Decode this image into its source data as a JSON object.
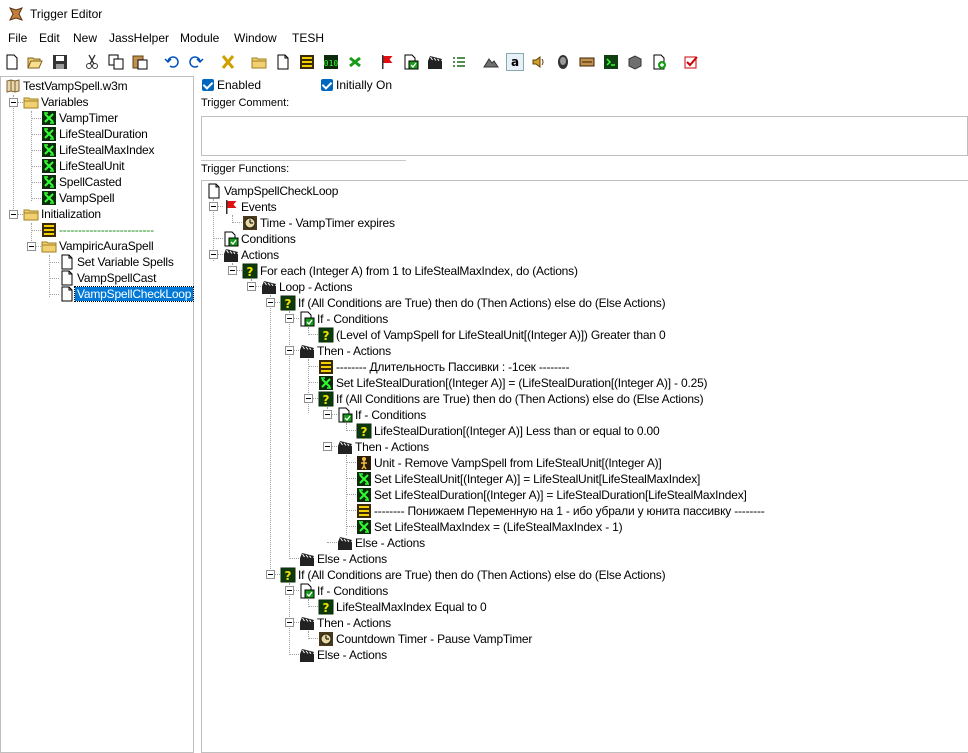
{
  "window": {
    "title": "Trigger Editor"
  },
  "menu": [
    "File",
    "Edit",
    "New",
    "JassHelper",
    "Module",
    "Window",
    "TESH"
  ],
  "toolbar_icons": [
    "new-icon",
    "open-icon",
    "save-icon",
    "cut-icon",
    "copy-icon",
    "paste-icon",
    "undo-icon",
    "redo-icon",
    "delete-icon",
    "folder-icon",
    "trigger-icon",
    "comment-icon",
    "variable-icon",
    "event-icon",
    "condition-icon",
    "action-icon",
    "checklist-icon",
    "terrain-icon",
    "object-icon",
    "sound-icon",
    "ai-icon",
    "campaign-icon",
    "import-icon",
    "script-icon",
    "map-icon",
    "test-icon"
  ],
  "left_tree": {
    "map": "TestVampSpell.w3m",
    "variables_folder": "Variables",
    "variables": [
      "VampTimer",
      "LifeStealDuration",
      "LifeStealMaxIndex",
      "LifeStealUnit",
      "SpellCasted",
      "VampSpell"
    ],
    "init_folder": "Initialization",
    "init_comment": "-------------------------",
    "spell_folder": "VampiricAuraSpell",
    "triggers": [
      "Set Variable Spells",
      "VampSpellCast",
      "VampSpellCheckLoop"
    ]
  },
  "panel": {
    "enabled": "Enabled",
    "initially_on": "Initially On",
    "comment_label": "Trigger Comment:",
    "functions_label": "Trigger Functions:"
  },
  "functions": [
    {
      "text": "VampSpellCheckLoop",
      "icon": "trigger"
    },
    {
      "text": "Events",
      "icon": "event"
    },
    {
      "text": "Time - VampTimer expires",
      "icon": "timer"
    },
    {
      "text": "Conditions",
      "icon": "condition"
    },
    {
      "text": "Actions",
      "icon": "action"
    },
    {
      "text": "For each (Integer A) from 1 to LifeStealMaxIndex, do (Actions)",
      "icon": "question"
    },
    {
      "text": "Loop - Actions",
      "icon": "action"
    },
    {
      "text": "If (All Conditions are True) then do (Then Actions) else do (Else Actions)",
      "icon": "question"
    },
    {
      "text": "If - Conditions",
      "icon": "condition"
    },
    {
      "text": "(Level of VampSpell for LifeStealUnit[(Integer A)]) Greater than 0",
      "icon": "question"
    },
    {
      "text": "Then - Actions",
      "icon": "action"
    },
    {
      "text": "-------- Длительность Пассивки : -1сек --------",
      "icon": "comment"
    },
    {
      "text": "Set LifeStealDuration[(Integer A)] = (LifeStealDuration[(Integer A)] - 0.25)",
      "icon": "variable"
    },
    {
      "text": "If (All Conditions are True) then do (Then Actions) else do (Else Actions)",
      "icon": "question"
    },
    {
      "text": "If - Conditions",
      "icon": "condition"
    },
    {
      "text": "LifeStealDuration[(Integer A)] Less than or equal to 0.00",
      "icon": "question"
    },
    {
      "text": "Then - Actions",
      "icon": "action"
    },
    {
      "text": "Unit - Remove VampSpell from LifeStealUnit[(Integer A)]",
      "icon": "unit"
    },
    {
      "text": "Set LifeStealUnit[(Integer A)] = LifeStealUnit[LifeStealMaxIndex]",
      "icon": "variable"
    },
    {
      "text": "Set LifeStealDuration[(Integer A)] = LifeStealDuration[LifeStealMaxIndex]",
      "icon": "variable"
    },
    {
      "text": "-------- Понижаем Переменную на 1 - ибо убрали у юнита пассивку --------",
      "icon": "comment"
    },
    {
      "text": "Set LifeStealMaxIndex = (LifeStealMaxIndex - 1)",
      "icon": "variable"
    },
    {
      "text": "Else - Actions",
      "icon": "action"
    },
    {
      "text": "Else - Actions",
      "icon": "action"
    },
    {
      "text": "If (All Conditions are True) then do (Then Actions) else do (Else Actions)",
      "icon": "question"
    },
    {
      "text": "If - Conditions",
      "icon": "condition"
    },
    {
      "text": "LifeStealMaxIndex Equal to 0",
      "icon": "question"
    },
    {
      "text": "Then - Actions",
      "icon": "action"
    },
    {
      "text": "Countdown Timer - Pause VampTimer",
      "icon": "timer"
    },
    {
      "text": "Else - Actions",
      "icon": "action"
    }
  ]
}
